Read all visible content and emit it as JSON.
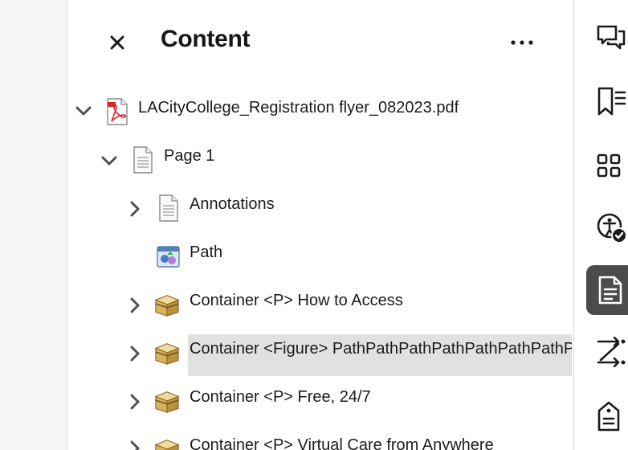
{
  "panel": {
    "title": "Content"
  },
  "tree": [
    {
      "label": "LACityCollege_Registration flyer_082023.pdf",
      "icon": "pdf-file-icon",
      "expander": "expanded",
      "depth": 0
    },
    {
      "label": "Page 1",
      "icon": "page-icon",
      "expander": "expanded",
      "depth": 1
    },
    {
      "label": "Annotations",
      "icon": "page-icon",
      "expander": "collapsed",
      "depth": 2
    },
    {
      "label": "Path",
      "icon": "path-image-icon",
      "expander": "none",
      "depth": 2
    },
    {
      "label": "Container <P> How to Access",
      "icon": "container-box-icon",
      "expander": "collapsed",
      "depth": 2
    },
    {
      "label": "Container <Figure> PathPathPathPathPathPathPathPath",
      "icon": "container-box-icon",
      "expander": "collapsed",
      "depth": 2,
      "selected": true
    },
    {
      "label": "Container <P> Free, 24/7",
      "icon": "container-box-icon",
      "expander": "collapsed",
      "depth": 2
    },
    {
      "label": "Container <P> Virtual Care from Anywhere",
      "icon": "container-box-icon",
      "expander": "collapsed",
      "depth": 2
    }
  ],
  "rail_icons": [
    "comment-icon",
    "bookmarks-icon",
    "thumbnails-icon",
    "accessibility-check-icon",
    "content-panel-icon",
    "reading-order-icon",
    "tags-icon"
  ],
  "colors": {
    "selection": "#e1e1e1",
    "active_rail": "#4b4b4b",
    "pdf_red": "#d7282f",
    "box_gold": "#c9a24a"
  }
}
